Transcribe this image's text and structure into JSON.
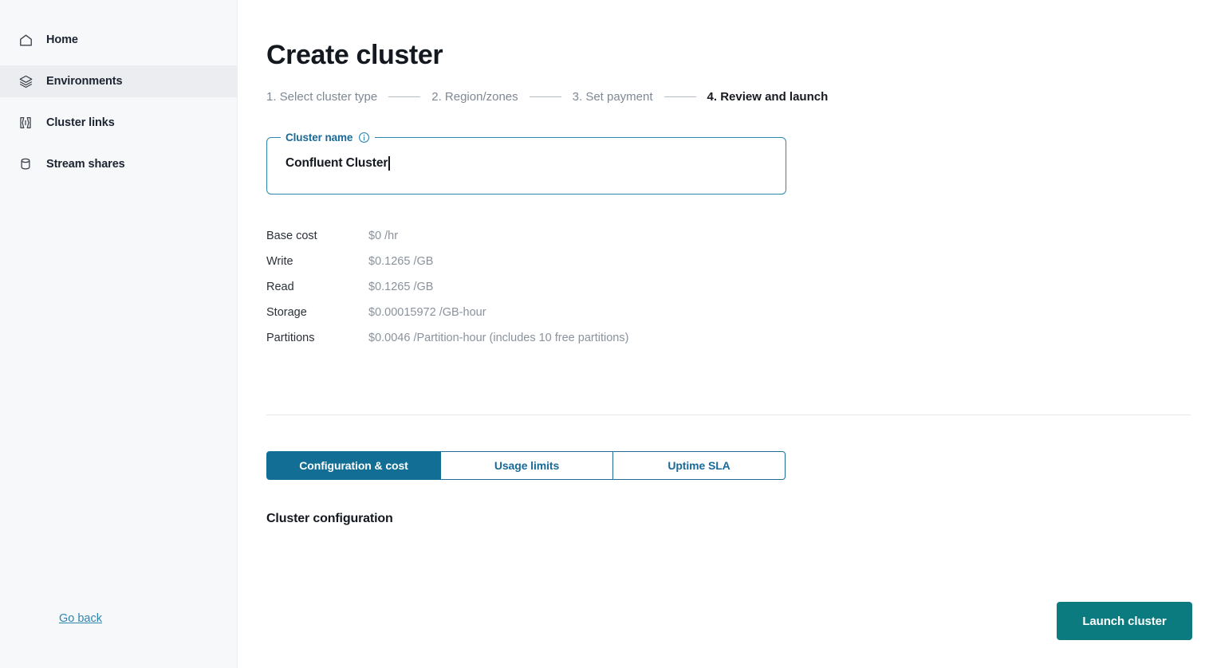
{
  "sidebar": {
    "items": [
      {
        "label": "Home",
        "icon": "home-icon",
        "active": false
      },
      {
        "label": "Environments",
        "icon": "layers-icon",
        "active": true
      },
      {
        "label": "Cluster links",
        "icon": "cluster-links-icon",
        "active": false
      },
      {
        "label": "Stream shares",
        "icon": "database-icon",
        "active": false
      }
    ]
  },
  "page": {
    "title": "Create cluster"
  },
  "stepper": {
    "steps": [
      {
        "label": "1. Select cluster type",
        "active": false
      },
      {
        "label": "2. Region/zones",
        "active": false
      },
      {
        "label": "3. Set payment",
        "active": false
      },
      {
        "label": "4. Review and launch",
        "active": true
      }
    ]
  },
  "cluster_name_field": {
    "label": "Cluster name",
    "info_icon": "info-icon",
    "value": "Confluent Cluster",
    "placeholder": "Cluster name"
  },
  "pricing": {
    "rows": [
      {
        "label": "Base cost",
        "value": "$0 /hr"
      },
      {
        "label": "Write",
        "value": "$0.1265 /GB"
      },
      {
        "label": "Read",
        "value": "$0.1265 /GB"
      },
      {
        "label": "Storage",
        "value": "$0.00015972 /GB-hour"
      },
      {
        "label": "Partitions",
        "value": "$0.0046 /Partition-hour (includes 10 free partitions)"
      }
    ]
  },
  "tabs": [
    {
      "label": "Configuration & cost",
      "active": true
    },
    {
      "label": "Usage limits",
      "active": false
    },
    {
      "label": "Uptime SLA",
      "active": false
    }
  ],
  "section": {
    "title": "Cluster configuration"
  },
  "footer": {
    "go_back_label": "Go back",
    "launch_label": "Launch cluster"
  },
  "colors": {
    "tab_active": "#126e94",
    "launch_button": "#0b7b7f",
    "link": "#2e86ae",
    "input_border": "#2e86ae",
    "sidebar_bg": "#f7f8fa",
    "sidebar_active_bg": "#ebedf0",
    "muted_text": "#8a929c"
  }
}
